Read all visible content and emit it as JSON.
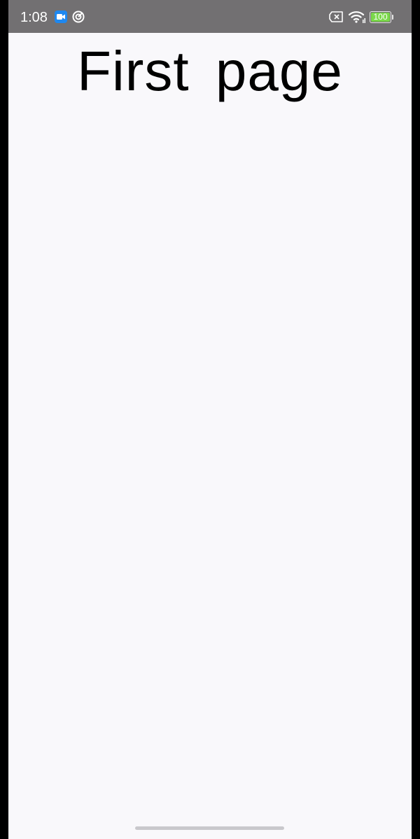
{
  "status_bar": {
    "time": "1:08",
    "battery_level": "100",
    "icons": [
      "screen-record-icon",
      "sync-icon",
      "no-sim-icon",
      "wifi-icon",
      "battery-icon"
    ]
  },
  "main": {
    "title": "First page"
  },
  "colors": {
    "status_bar_bg": "#727072",
    "page_bg": "#f9f8fb",
    "record_accent": "#1e88f0",
    "battery_fill": "#7ad84a"
  }
}
